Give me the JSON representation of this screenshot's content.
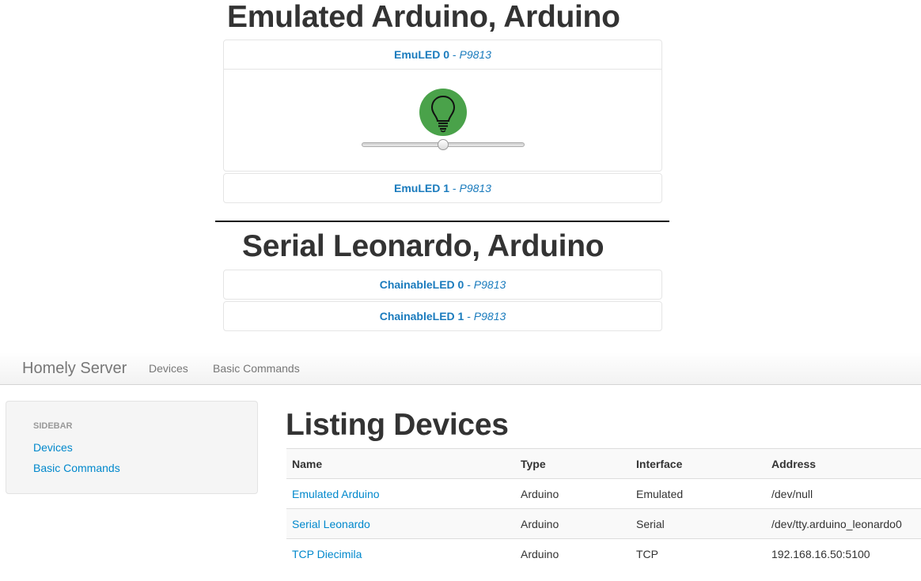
{
  "device_panels": [
    {
      "title": "Emulated Arduino, Arduino",
      "items": [
        {
          "name": "EmuLED 0",
          "separator": " - ",
          "pin": "P9813",
          "expanded": true,
          "brightness": 0.5
        },
        {
          "name": "EmuLED 1",
          "separator": " - ",
          "pin": "P9813",
          "expanded": false
        }
      ]
    },
    {
      "title": "Serial Leonardo, Arduino",
      "items": [
        {
          "name": "ChainableLED 0",
          "separator": " - ",
          "pin": "P9813",
          "expanded": false
        },
        {
          "name": "ChainableLED 1",
          "separator": " - ",
          "pin": "P9813",
          "expanded": false
        }
      ]
    }
  ],
  "bulb_color": "#4aa24a",
  "navbar": {
    "brand": "Homely Server",
    "links": [
      "Devices",
      "Basic Commands"
    ]
  },
  "sidebar": {
    "header": "SIDEBAR",
    "links": [
      "Devices",
      "Basic Commands"
    ]
  },
  "listing": {
    "title": "Listing Devices",
    "columns": [
      "Name",
      "Type",
      "Interface",
      "Address"
    ],
    "rows": [
      {
        "name": "Emulated Arduino",
        "type": "Arduino",
        "interface": "Emulated",
        "address": "/dev/null"
      },
      {
        "name": "Serial Leonardo",
        "type": "Arduino",
        "interface": "Serial",
        "address": "/dev/tty.arduino_leonardo0"
      },
      {
        "name": "TCP Diecimila",
        "type": "Arduino",
        "interface": "TCP",
        "address": "192.168.16.50:5100"
      }
    ]
  },
  "link_color": "#0088cc"
}
